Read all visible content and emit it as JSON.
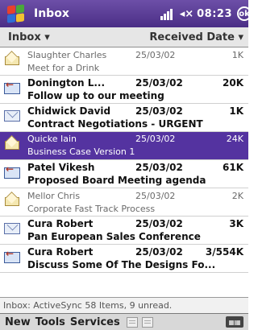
{
  "titlebar": {
    "title": "Inbox",
    "time": "08:23",
    "icons": [
      "windows-start-icon",
      "signal-icon",
      "speaker-icon",
      "ok-icon"
    ]
  },
  "subheader": {
    "folder": "Inbox ▾",
    "sort": "Received Date ▾"
  },
  "messages": [
    {
      "sender": "Slaughter Charles",
      "date": "25/03/02",
      "size": "1K",
      "subject": "Meet for a Drink",
      "state": "read",
      "icon": "open-envelope-icon"
    },
    {
      "sender": "Donington L...",
      "date": "25/03/02",
      "size": "20K",
      "subject": "Follow up to our meeting",
      "state": "unread",
      "icon": "replied-envelope-icon"
    },
    {
      "sender": "Chidwick David",
      "date": "25/03/02",
      "size": "1K",
      "subject": "Contract Negotiations - URGENT",
      "state": "unread",
      "icon": "closed-envelope-icon"
    },
    {
      "sender": "Quicke Iain",
      "date": "25/03/02",
      "size": "24K",
      "subject": "Business Case Version 1",
      "state": "selected",
      "icon": "open-envelope-icon"
    },
    {
      "sender": "Patel Vikesh",
      "date": "25/03/02",
      "size": "61K",
      "subject": "Proposed Board Meeting agenda",
      "state": "unread",
      "icon": "replied-envelope-icon"
    },
    {
      "sender": "Mellor Chris",
      "date": "25/03/02",
      "size": "2K",
      "subject": "Corporate Fast Track Process",
      "state": "read",
      "icon": "open-envelope-icon"
    },
    {
      "sender": "Cura Robert",
      "date": "25/03/02",
      "size": "3K",
      "subject": "Pan European Sales Conference",
      "state": "unread",
      "icon": "closed-envelope-icon"
    },
    {
      "sender": "Cura Robert",
      "date": "25/03/02",
      "size": "3/554K",
      "subject": "Discuss Some Of The Designs Fo...",
      "state": "unread",
      "icon": "replied-envelope-icon"
    }
  ],
  "statusbar": {
    "text": "Inbox: ActiveSync  58 Items, 9 unread."
  },
  "menubar": {
    "new": "New",
    "tools": "Tools",
    "services": "Services",
    "icons": [
      "reply-toolbar-icon",
      "properties-toolbar-icon",
      "keyboard-icon"
    ]
  }
}
